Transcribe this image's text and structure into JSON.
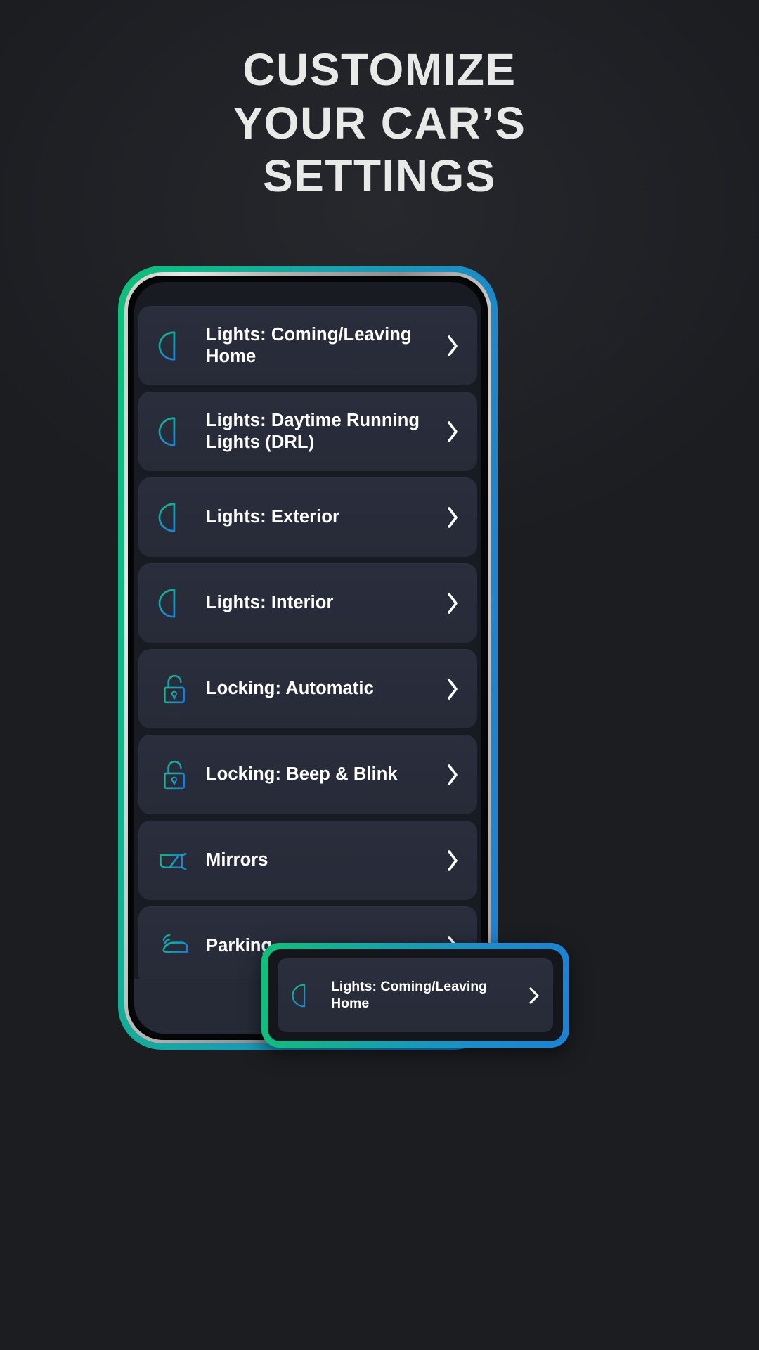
{
  "headline": {
    "line1": "CUSTOMIZE",
    "line2": "YOUR CAR’S",
    "line3": "SETTINGS"
  },
  "colors": {
    "background": "#1b1d21",
    "headline_text": "#e9e9e7",
    "card_background": "#2a2e3c",
    "card_text": "#ffffff",
    "accent_green": "#0ec07c",
    "accent_blue": "#1b82d6",
    "icon_teal": "#18b39c",
    "nav_home_blue": "#3c8fd9",
    "phone_screen": "#181b22"
  },
  "phone": {
    "settings_list": [
      {
        "label": "Lights: Coming/Leaving Home",
        "icon": "headlight-icon",
        "chevron": "›"
      },
      {
        "label": "Lights: Daytime Running Lights (DRL)",
        "icon": "headlight-icon",
        "chevron": "›"
      },
      {
        "label": "Lights: Exterior",
        "icon": "headlight-icon",
        "chevron": "›"
      },
      {
        "label": "Lights: Interior",
        "icon": "headlight-icon",
        "chevron": "›"
      },
      {
        "label": "Locking: Automatic",
        "icon": "padlock-open-icon",
        "chevron": "›"
      },
      {
        "label": "Locking: Beep & Blink",
        "icon": "padlock-open-icon",
        "chevron": "›"
      },
      {
        "label": "Mirrors",
        "icon": "side-mirror-icon",
        "chevron": "›"
      },
      {
        "label": "Parking",
        "icon": "parking-sensor-icon",
        "chevron": "›"
      }
    ],
    "nav": {
      "home_icon": "home-icon"
    }
  },
  "callout": {
    "label": "Lights: Coming/Leaving Home",
    "icon": "headlight-icon",
    "chevron": "›"
  }
}
